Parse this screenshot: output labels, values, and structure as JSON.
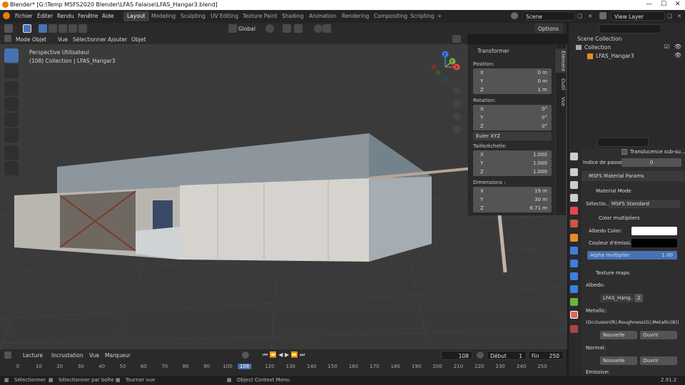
{
  "window": {
    "title": "Blender* [G:\\Temp MSFS2020 Blender\\LFAS Falaise\\LFAS_Hangar3.blend]"
  },
  "menus": [
    "Fichier",
    "Éditer",
    "Rendu",
    "Fenêtre",
    "Aide"
  ],
  "workspaces": [
    "Layout",
    "Modeling",
    "Sculpting",
    "UV Editing",
    "Texture Paint",
    "Shading",
    "Animation",
    "Rendering",
    "Compositing",
    "Scripting",
    "+"
  ],
  "active_workspace": "Layout",
  "scene": {
    "label": "Scene",
    "view_layer": "View Layer"
  },
  "toolbar": {
    "orientation": "Global",
    "options": "Options"
  },
  "header": {
    "mode": "Mode Objet",
    "vue": "Vue",
    "selection": "Sélectionner",
    "ajouter": "Ajouter",
    "objet": "Objet"
  },
  "viewport": {
    "perspective": "Perspective Utilisateur",
    "collection_info": "(108) Collection | LFAS_Hangar3",
    "gizmo": {
      "x": "X",
      "y": "Y",
      "z": "Z"
    }
  },
  "npanel": {
    "title": "Transformer",
    "position_label": "Position:",
    "position": [
      {
        "k": "X",
        "v": "0 m"
      },
      {
        "k": "Y",
        "v": "0 m"
      },
      {
        "k": "Z",
        "v": "1 m"
      }
    ],
    "rotation_label": "Rotation:",
    "rotation": [
      {
        "k": "X",
        "v": "0°"
      },
      {
        "k": "Y",
        "v": "0°"
      },
      {
        "k": "Z",
        "v": "0°"
      }
    ],
    "rotation_mode": "Euler XYZ",
    "scale_label": "Taille/échelle:",
    "scale": [
      {
        "k": "X",
        "v": "1.000"
      },
      {
        "k": "Y",
        "v": "1.000"
      },
      {
        "k": "Z",
        "v": "1.000"
      }
    ],
    "dimensions_label": "Dimensions :",
    "dimensions": [
      {
        "k": "X",
        "v": "19 m"
      },
      {
        "k": "Y",
        "v": "30 m"
      },
      {
        "k": "Z",
        "v": "6.71 m"
      }
    ],
    "tabs": [
      "Élément",
      "Outil",
      "Vue"
    ]
  },
  "outliner": {
    "scene_collection": "Scene Collection",
    "collection": "Collection",
    "object": "LFAS_Hangar3"
  },
  "properties": {
    "translucence": "Translucence sub-su...",
    "pass_index_label": "Indice de passe",
    "pass_index_value": "0",
    "msfs_header": "MSFS Material Params",
    "material_mode": "Material Mode",
    "selection_label": "Sélectio...",
    "selection_value": "MSFS Standard",
    "color_multipliers": "Color multipliers",
    "albedo_color": "Albedo Color:",
    "emissive_color": "Couleur d'émissi...",
    "alpha_label": "Alpha multiplier",
    "alpha_value": "1.00",
    "texture_maps": "Texture maps",
    "albedo": "Albedo:",
    "albedo_texture": "LFAS_Hang...",
    "albedo_users": "2",
    "metallic": "Metallic:",
    "metallic_desc": "(Occlusion(R),Roughness(G),Metallic(B))",
    "new_btn": "Nouvelle",
    "open_btn": "Ouvrir",
    "normal": "Normal:",
    "emissive": "Emissive:"
  },
  "timeline": {
    "lecture": "Lecture",
    "incrustation": "Incrustation",
    "vue": "Vue",
    "marqueur": "Marqueur",
    "current_frame": "108",
    "debut_label": "Début",
    "debut_value": "1",
    "fin_label": "Fin",
    "fin_value": "250",
    "ticks": [
      "0",
      "10",
      "20",
      "30",
      "40",
      "50",
      "60",
      "70",
      "80",
      "90",
      "100",
      "108",
      "120",
      "130",
      "140",
      "150",
      "160",
      "170",
      "180",
      "190",
      "200",
      "210",
      "220",
      "230",
      "240",
      "250"
    ]
  },
  "status": {
    "select": "Sélectionner",
    "box": "Sélectionner par boîte",
    "rotate": "Tourner vue",
    "context": "Object Context Menu",
    "version": "2.91.2"
  },
  "colors": {
    "accent": "#4772b3",
    "orange": "#e87d0d",
    "bg": "#393939"
  }
}
